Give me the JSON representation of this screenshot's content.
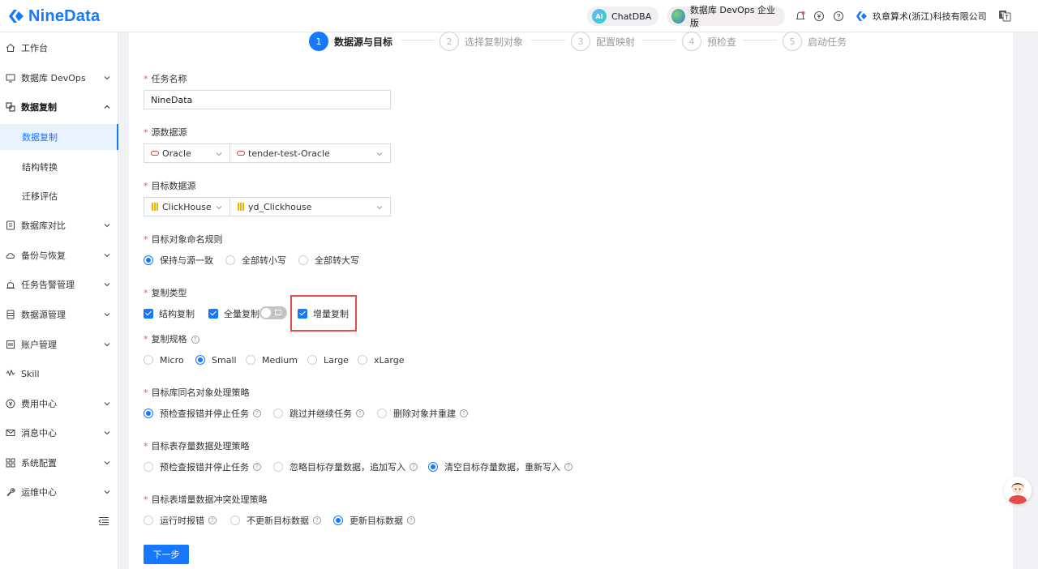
{
  "app": {
    "brand": "NineData"
  },
  "topbar": {
    "chatdba": "ChatDBA",
    "chatdba_icon": "AI",
    "devops": "数据库 DevOps 企业版",
    "company": "玖章算术(浙江)科技有限公司"
  },
  "sidebar": {
    "items": [
      {
        "label": "工作台",
        "icon": "home-icon"
      },
      {
        "label": "数据库 DevOps",
        "icon": "monitor-icon"
      },
      {
        "label": "数据复制",
        "icon": "copy-icon"
      },
      {
        "label": "数据复制"
      },
      {
        "label": "结构转换"
      },
      {
        "label": "迁移评估"
      },
      {
        "label": "数据库对比",
        "icon": "compare-icon"
      },
      {
        "label": "备份与恢复",
        "icon": "cloud-icon"
      },
      {
        "label": "任务告警管理",
        "icon": "alarm-icon"
      },
      {
        "label": "数据源管理",
        "icon": "database-icon"
      },
      {
        "label": "账户管理",
        "icon": "account-icon"
      },
      {
        "label": "Skill",
        "icon": "skill-icon"
      },
      {
        "label": "费用中心",
        "icon": "yen-icon"
      },
      {
        "label": "消息中心",
        "icon": "mail-icon"
      },
      {
        "label": "系统配置",
        "icon": "grid-icon"
      },
      {
        "label": "运维中心",
        "icon": "wrench-icon"
      }
    ]
  },
  "steps": [
    {
      "num": "1",
      "label": "数据源与目标"
    },
    {
      "num": "2",
      "label": "选择复制对象"
    },
    {
      "num": "3",
      "label": "配置映射"
    },
    {
      "num": "4",
      "label": "预检查"
    },
    {
      "num": "5",
      "label": "启动任务"
    }
  ],
  "form": {
    "task_name": {
      "label": "任务名称",
      "value": "NineData"
    },
    "source": {
      "label": "源数据源",
      "type": "Oracle",
      "instance": "tender-test-Oracle"
    },
    "target": {
      "label": "目标数据源",
      "type": "ClickHouse",
      "instance": "yd_Clickhouse"
    },
    "naming_rule": {
      "label": "目标对象命名规则",
      "options": [
        "保持与源一致",
        "全部转小写",
        "全部转大写"
      ],
      "selected": 0
    },
    "copy_type": {
      "label": "复制类型",
      "options": [
        "结构复制",
        "全量复制",
        "增量复制"
      ]
    },
    "spec": {
      "label": "复制规格",
      "options": [
        "Micro",
        "Small",
        "Medium",
        "Large",
        "xLarge"
      ],
      "selected": 1
    },
    "same_name": {
      "label": "目标库同名对象处理策略",
      "options": [
        "预检查报错并停止任务",
        "跳过并继续任务",
        "删除对象并重建"
      ],
      "selected": 0
    },
    "existing_data": {
      "label": "目标表存量数据处理策略",
      "options": [
        "预检查报错并停止任务",
        "忽略目标存量数据，追加写入",
        "清空目标存量数据，重新写入"
      ],
      "selected": 2
    },
    "conflict": {
      "label": "目标表增量数据冲突处理策略",
      "options": [
        "运行时报错",
        "不更新目标数据",
        "更新目标数据"
      ],
      "selected": 2
    },
    "next": "下一步"
  },
  "colors": {
    "primary": "#1677ff",
    "required": "#ff4d4f",
    "highlight": "#e84a4a"
  }
}
